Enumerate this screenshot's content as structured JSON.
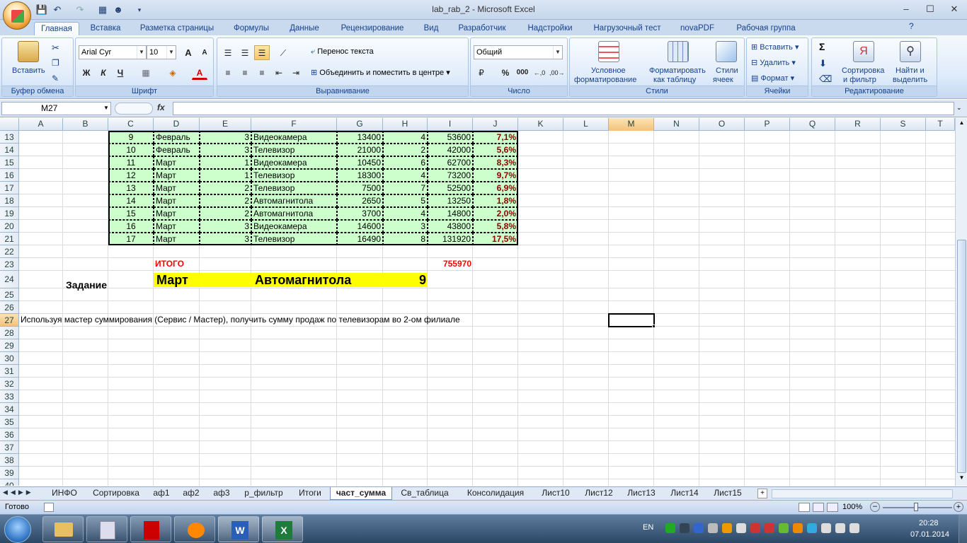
{
  "window": {
    "title": "lab_rab_2 - Microsoft Excel",
    "minimize": "–",
    "maximize": "☐",
    "close": "✕"
  },
  "ribbon_tabs": [
    "Главная",
    "Вставка",
    "Разметка страницы",
    "Формулы",
    "Данные",
    "Рецензирование",
    "Вид",
    "Разработчик",
    "Надстройки",
    "Нагрузочный тест",
    "novaPDF",
    "Рабочая группа"
  ],
  "ribbon": {
    "clipboard": {
      "label": "Буфер обмена",
      "paste": "Вставить"
    },
    "font": {
      "label": "Шрифт",
      "family": "Arial Cyr",
      "size": "10",
      "bold": "Ж",
      "italic": "К",
      "underline": "Ч",
      "grow": "A",
      "shrink": "A"
    },
    "align": {
      "label": "Выравнивание",
      "wrap": "Перенос текста",
      "merge": "Объединить и поместить в центре"
    },
    "number": {
      "label": "Число",
      "format": "Общий",
      "percent": "%",
      "thousands": "000"
    },
    "styles": {
      "label": "Стили",
      "cond1": "Условное",
      "cond2": "форматирование",
      "table1": "Форматировать",
      "table2": "как таблицу",
      "cell1": "Стили",
      "cell2": "ячеек"
    },
    "cells": {
      "label": "Ячейки",
      "insert": "Вставить",
      "delete": "Удалить",
      "format": "Формат"
    },
    "editing": {
      "label": "Редактирование",
      "sum": "Σ",
      "sort1": "Сортировка",
      "sort2": "и фильтр",
      "find1": "Найти и",
      "find2": "выделить"
    }
  },
  "formula_bar": {
    "name_box": "M27",
    "fx": "fx",
    "formula": ""
  },
  "columns": [
    "A",
    "B",
    "C",
    "D",
    "E",
    "F",
    "G",
    "H",
    "I",
    "J",
    "K",
    "L",
    "M",
    "N",
    "O",
    "P",
    "Q",
    "R",
    "S",
    "T"
  ],
  "rows": [
    "13",
    "14",
    "15",
    "16",
    "17",
    "18",
    "19",
    "20",
    "21",
    "22",
    "23",
    "24",
    "25",
    "26",
    "27",
    "28",
    "29",
    "30",
    "31",
    "32",
    "33",
    "34",
    "35",
    "36",
    "37",
    "38",
    "39",
    "40"
  ],
  "table_rows": [
    {
      "c": "9",
      "d": "Февраль",
      "e": "3",
      "f": "Видеокамера",
      "g": "13400",
      "h": "4",
      "i": "53600",
      "j": "7,1%"
    },
    {
      "c": "10",
      "d": "Февраль",
      "e": "3",
      "f": "Телевизор",
      "g": "21000",
      "h": "2",
      "i": "42000",
      "j": "5,6%"
    },
    {
      "c": "11",
      "d": "Март",
      "e": "1",
      "f": "Видеокамера",
      "g": "10450",
      "h": "6",
      "i": "62700",
      "j": "8,3%"
    },
    {
      "c": "12",
      "d": "Март",
      "e": "1",
      "f": "Телевизор",
      "g": "18300",
      "h": "4",
      "i": "73200",
      "j": "9,7%"
    },
    {
      "c": "13",
      "d": "Март",
      "e": "2",
      "f": "Телевизор",
      "g": "7500",
      "h": "7",
      "i": "52500",
      "j": "6,9%"
    },
    {
      "c": "14",
      "d": "Март",
      "e": "2",
      "f": "Автомагнитола",
      "g": "2650",
      "h": "5",
      "i": "13250",
      "j": "1,8%"
    },
    {
      "c": "15",
      "d": "Март",
      "e": "2",
      "f": "Автомагнитола",
      "g": "3700",
      "h": "4",
      "i": "14800",
      "j": "2,0%"
    },
    {
      "c": "16",
      "d": "Март",
      "e": "3",
      "f": "Видеокамера",
      "g": "14600",
      "h": "3",
      "i": "43800",
      "j": "5,8%"
    },
    {
      "c": "17",
      "d": "Март",
      "e": "3",
      "f": "Телевизор",
      "g": "16490",
      "h": "8",
      "i": "131920",
      "j": "17,5%"
    }
  ],
  "totals": {
    "label": "ИТОГО",
    "value": "755970"
  },
  "highlight": {
    "month": "Март",
    "product": "Автомагнитола",
    "count": "9"
  },
  "task": {
    "heading": "Задание",
    "text": "Используя мастер суммирования (Сервис / Мастер), получить сумму продаж по телевизорам во 2-ом филиале"
  },
  "sheet_tabs": [
    "ИНФО",
    "Сортировка",
    "аф1",
    "аф2",
    "аф3",
    "р_фильтр",
    "Итоги",
    "част_сумма",
    "Св_таблица",
    "Консолидация",
    "Лист10",
    "Лист12",
    "Лист13",
    "Лист14",
    "Лист15"
  ],
  "active_sheet": "част_сумма",
  "status": {
    "ready": "Готово",
    "zoom": "100%"
  },
  "taskbar": {
    "lang": "EN",
    "time": "20:28",
    "date": "07.01.2014"
  },
  "colors": {
    "table_fill": "#ccffcc",
    "highlight_fill": "#ffff00",
    "total_red": "#ff0000",
    "percent": "#8b0000"
  }
}
